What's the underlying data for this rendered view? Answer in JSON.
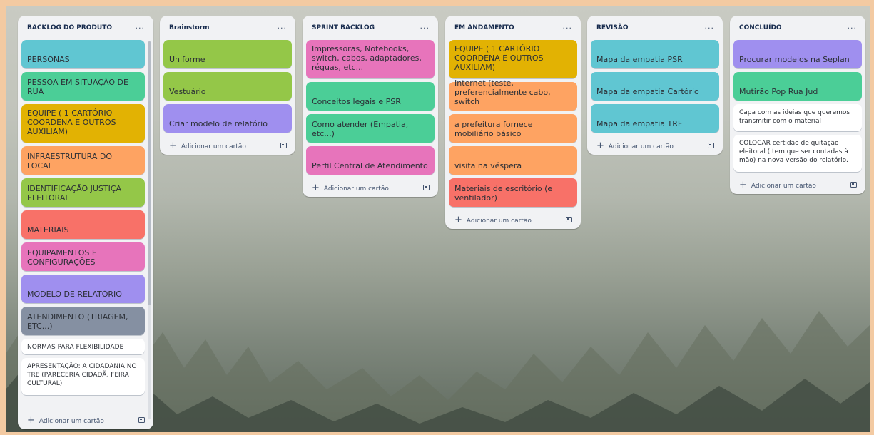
{
  "board": {
    "add_card_label": "Adicionar um cartão",
    "menu_glyph": "···",
    "lists": [
      {
        "title": "BACKLOG DO PRODUTO",
        "cards": [
          {
            "text": "PERSONAS",
            "color": "#60c6d2"
          },
          {
            "text": "PESSOA EM SITUAÇÃO DE RUA",
            "color": "#4bce97"
          },
          {
            "text": "EQUIPE ( 1 CARTÓRIO COORDENA E OUTROS AUXILIAM)",
            "color": "#e2b203"
          },
          {
            "text": "INFRAESTRUTURA DO LOCAL",
            "color": "#fea362"
          },
          {
            "text": "IDENTIFICAÇÃO JUSTIÇA ELEITORAL",
            "color": "#94c748"
          },
          {
            "text": "MATERIAIS",
            "color": "#f87168"
          },
          {
            "text": "EQUIPAMENTOS E CONFIGURAÇÕES",
            "color": "#e774bb"
          },
          {
            "text": "MODELO DE RELATÓRIO",
            "color": "#9f8fef"
          },
          {
            "text": "ATENDIMENTO (TRIAGEM, ETC...)",
            "color": "#8590a2"
          },
          {
            "text": "NORMAS PARA FLEXIBILIDADE",
            "color": "#ffffff"
          },
          {
            "text": "APRESENTAÇÃO: A CIDADANIA NO TRE (PARECERIA CIDADÃ, FEIRA CULTURAL)",
            "color": "#ffffff"
          }
        ]
      },
      {
        "title": "Brainstorm",
        "cards": [
          {
            "text": "Uniforme",
            "color": "#94c748"
          },
          {
            "text": "Vestuário",
            "color": "#94c748"
          },
          {
            "text": "Criar modelo de relatório",
            "color": "#9f8fef"
          }
        ]
      },
      {
        "title": "SPRINT BACKLOG",
        "cards": [
          {
            "text": "Impressoras, Notebooks, switch, cabos, adaptadores, réguas, etc...",
            "color": "#e774bb"
          },
          {
            "text": "Conceitos legais e PSR",
            "color": "#4bce97"
          },
          {
            "text": "Como atender (Empatia, etc...)",
            "color": "#4bce97"
          },
          {
            "text": "Perfil Central de Atendimento",
            "color": "#e774bb"
          }
        ]
      },
      {
        "title": "EM ANDAMENTO",
        "cards": [
          {
            "text": "EQUIPE ( 1 CARTÓRIO COORDENA E OUTROS AUXILIAM)",
            "color": "#e2b203"
          },
          {
            "text": "Internet (teste, preferencialmente cabo, switch",
            "color": "#fea362"
          },
          {
            "text": "a prefeitura fornece mobiliário básico",
            "color": "#fea362"
          },
          {
            "text": "visita na véspera",
            "color": "#fea362"
          },
          {
            "text": "Materiais de escritório (e ventilador)",
            "color": "#f87168"
          }
        ]
      },
      {
        "title": "REVISÃO",
        "cards": [
          {
            "text": "Mapa da empatia PSR",
            "color": "#60c6d2"
          },
          {
            "text": "Mapa da empatia Cartório",
            "color": "#60c6d2"
          },
          {
            "text": "Mapa da empatia TRF",
            "color": "#60c6d2"
          }
        ]
      },
      {
        "title": "CONCLUÍDO",
        "cards": [
          {
            "text": "Procurar modelos na Seplan",
            "color": "#9f8fef"
          },
          {
            "text": "Mutirão Pop Rua Jud",
            "color": "#4bce97"
          },
          {
            "text": "Capa com as ideias que queremos transmitir com o material",
            "color": "#ffffff"
          },
          {
            "text": "COLOCAR certidão de quitação eleitoral ( tem que ser contadas à mão) na nova versão do relatório.",
            "color": "#ffffff"
          }
        ]
      }
    ]
  }
}
